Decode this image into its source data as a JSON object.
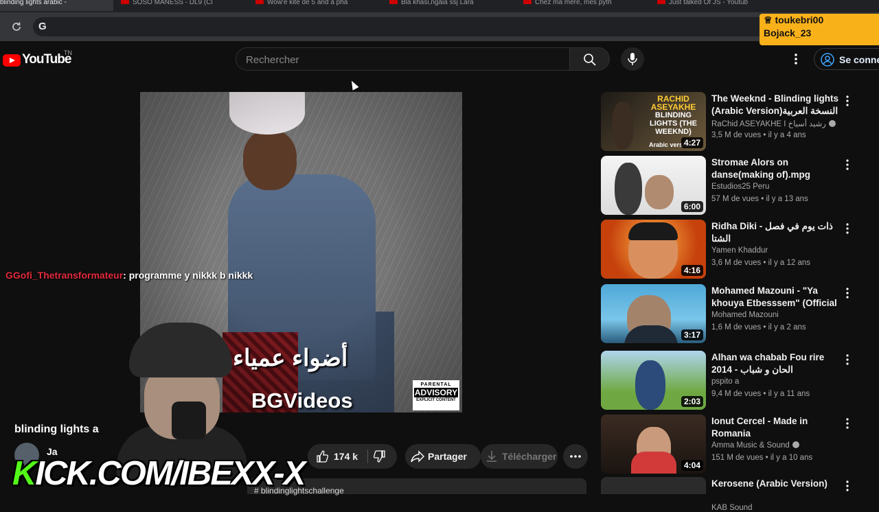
{
  "browser": {
    "tabs": [
      {
        "label": "blinding lights arabic -"
      },
      {
        "label": "SOSO MANESS - DL9 (Cl"
      },
      {
        "label": "Wow'e kite de 5 and a pha"
      },
      {
        "label": "Bla khasi,ngaia ssj Lara"
      },
      {
        "label": "Chez ma mere, mes pyth"
      },
      {
        "label": "Just talked Of JS - Youtub"
      }
    ],
    "omnibox_value": ""
  },
  "overlay": {
    "users": [
      "toukebri00",
      "Bojack_23"
    ]
  },
  "header": {
    "logo_text": "YouTube",
    "logo_region": "TN",
    "search_placeholder": "Rechercher",
    "signin_label": "Se connecter"
  },
  "player": {
    "arabic_title": "أضواء عمياء",
    "brand_text": "BGVideos",
    "advisory": {
      "line1": "PARENTAL",
      "line2": "ADVISORY",
      "line3": "EXPLICIT CONTENT"
    }
  },
  "chat": {
    "user": "GGofi_Thetransformateur",
    "message": ": programme y nikkk b nikkk"
  },
  "video": {
    "title": "blinding lights a",
    "channel": "Ja",
    "likes": "174 k",
    "share_label": "Partager",
    "download_label": "Télécharger",
    "description_snippet": "# blindinglightschallenge"
  },
  "stream": {
    "kick_k": "K",
    "kick_rest": "ICK.COM/IBEXX-X"
  },
  "recommendations": [
    {
      "title": "The Weeknd - Blinding lights (Arabic Version)النسخة العربية (On...",
      "channel": "RaChid ASEYAKHE I رشيد أسياخ",
      "verified": true,
      "meta": "3,5 M de vues • il y a 4 ans",
      "duration": "4:27",
      "thumb_top": "RACHID ASEYAKHE",
      "thumb_mid": "BLINDING LIGHTS (THE WEEKND)",
      "thumb_bot": "Arabic version"
    },
    {
      "title": "Stromae   Alors on danse(making of).mpg",
      "channel": "Estudios25 Peru",
      "verified": false,
      "meta": "57 M de vues • il y a 13 ans",
      "duration": "6:00"
    },
    {
      "title": "Ridha Diki - ذات يوم في فصل الشتا",
      "channel": "Yamen Khaddur",
      "verified": false,
      "meta": "3,6 M de vues • il y a 12 ans",
      "duration": "4:16"
    },
    {
      "title": "Mohamed Mazouni - \"Ya khouya Etbesssem\" (Official Music ...",
      "channel": "Mohamed Mazouni",
      "verified": false,
      "meta": "1,6 M de vues • il y a 2 ans",
      "duration": "3:17"
    },
    {
      "title": "Alhan wa chabab Fou rire 2014 - الحان و شباب",
      "channel": "pspito a",
      "verified": false,
      "meta": "9,4 M de vues • il y a 11 ans",
      "duration": "2:03"
    },
    {
      "title": "Ionut Cercel - Made in Romania",
      "channel": "Amma Music & Sound",
      "verified": true,
      "meta": "151 M de vues • il y a 10 ans",
      "duration": "4:04"
    },
    {
      "title": "Kerosene (Arabic Version)",
      "channel": "KAB Sound",
      "verified": false,
      "meta": "",
      "duration": ""
    }
  ]
}
